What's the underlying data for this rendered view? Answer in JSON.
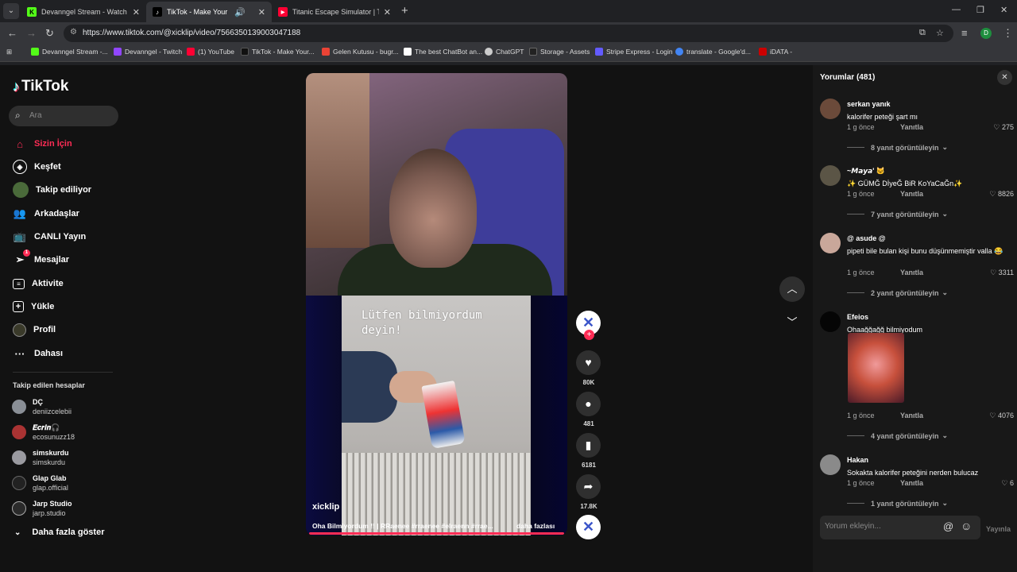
{
  "browser": {
    "tabs": [
      {
        "title": "Devanngel Stream - Watch Live",
        "fav_color": "#53fc18",
        "fav_text": "K"
      },
      {
        "title": "TikTok - Make Your Day",
        "fav_color": "#000000",
        "fav_text": "♪"
      },
      {
        "title": "Titanic Escape Simulator | Traile",
        "fav_color": "#ff0033",
        "fav_text": "▶"
      }
    ],
    "url": "https://www.tiktok.com/@xicklip/video/7566350139003047188",
    "bookmarks": [
      {
        "label": "Devanngel Stream -...",
        "color": "#53fc18"
      },
      {
        "label": "Devanngel - Twitch",
        "color": "#9146ff"
      },
      {
        "label": "(1) YouTube",
        "color": "#ff0033"
      },
      {
        "label": "TikTok - Make Your...",
        "color": "#111111"
      },
      {
        "label": "Gelen Kutusu - bugr...",
        "color": "#ea4335"
      },
      {
        "label": "The best ChatBot an...",
        "color": "#ffffff"
      },
      {
        "label": "ChatGPT",
        "color": "#cccccc"
      },
      {
        "label": "Storage - Assets",
        "color": "#222222"
      },
      {
        "label": "Stripe Express - Login",
        "color": "#635bff"
      },
      {
        "label": "translate - Google'd...",
        "color": "#4285f4"
      },
      {
        "label": "iDATA -",
        "color": "#c00"
      }
    ],
    "profile_initial": "D"
  },
  "sidebar": {
    "logo": "TikTok",
    "search_placeholder": "Ara",
    "nav": [
      {
        "label": "Sizin İçin",
        "icon": "home-icon",
        "active": true
      },
      {
        "label": "Keşfet",
        "icon": "compass-icon"
      },
      {
        "label": "Takip ediliyor",
        "icon": "following-avatar-icon"
      },
      {
        "label": "Arkadaşlar",
        "icon": "friends-icon"
      },
      {
        "label": "CANLI Yayın",
        "icon": "live-tv-icon"
      },
      {
        "label": "Mesajlar",
        "icon": "messages-icon",
        "badge": "1"
      },
      {
        "label": "Aktivite",
        "icon": "activity-icon"
      },
      {
        "label": "Yükle",
        "icon": "upload-icon"
      },
      {
        "label": "Profil",
        "icon": "profile-icon"
      },
      {
        "label": "Dahası",
        "icon": "more-dots-icon"
      }
    ],
    "following_title": "Takip edilen hesaplar",
    "accounts": [
      {
        "name": "DÇ",
        "handle": "deniizcelebii"
      },
      {
        "name": "𝑬𝒄𝒓𝒊𝒏🎧",
        "handle": "ecosunuzz18"
      },
      {
        "name": "simskurdu",
        "handle": "simskurdu"
      },
      {
        "name": "Glap Glab",
        "handle": "glap.official"
      },
      {
        "name": "Jarp Studio",
        "handle": "jarp.studio"
      }
    ],
    "show_more": "Daha fazla göster"
  },
  "video": {
    "overlay_text": "Lütfen bilmiyordum deyin!",
    "author": "xicklip",
    "caption": "Oha Bilmiyordum !! | RRaenee #rraenee #elraenn #rrae...",
    "more": "daha fazlası",
    "progress": 1.0
  },
  "actions": {
    "likes": "80K",
    "comments": "481",
    "saves": "6181",
    "shares": "17.8K"
  },
  "comments": {
    "title": "Yorumlar (481)",
    "reply_label": "Yanıtla",
    "items": [
      {
        "user": "serkan yanık",
        "text": "kalorifer peteği şart mı",
        "time": "1 g önce",
        "likes": "275",
        "view": "8 yanıt görüntüleyin",
        "avatar": "#6b4a3a"
      },
      {
        "user": "~𝙈𝙖𝙮𝙖' 🐱",
        "text": "✨ GÜMĞ DİyeĞ BiR KoYaCaĞn✨",
        "time": "1 g önce",
        "likes": "8826",
        "view": "7 yanıt görüntüleyin",
        "avatar": "#5b5546"
      },
      {
        "user": "@ asude @",
        "text": "pipeti bile bulan kişi bunu düşünmemiştir valla 😂",
        "time": "1 g önce",
        "likes": "3311",
        "view": "2 yanıt görüntüleyin",
        "avatar": "#c9a79a"
      },
      {
        "user": "Efeios",
        "text": "Ohaağğağğ bilmiyodum",
        "time": "1 g önce",
        "likes": "4076",
        "view": "4 yanıt görüntüleyin",
        "avatar": "#050505"
      },
      {
        "user": "Hakan",
        "text": "Sokakta kalorifer peteğini nerden bulucaz",
        "time": "1 g önce",
        "likes": "6",
        "view": "1 yanıt görüntüleyin",
        "avatar": "#888888"
      }
    ],
    "input_placeholder": "Yorum ekleyin...",
    "post_label": "Yayınla"
  }
}
